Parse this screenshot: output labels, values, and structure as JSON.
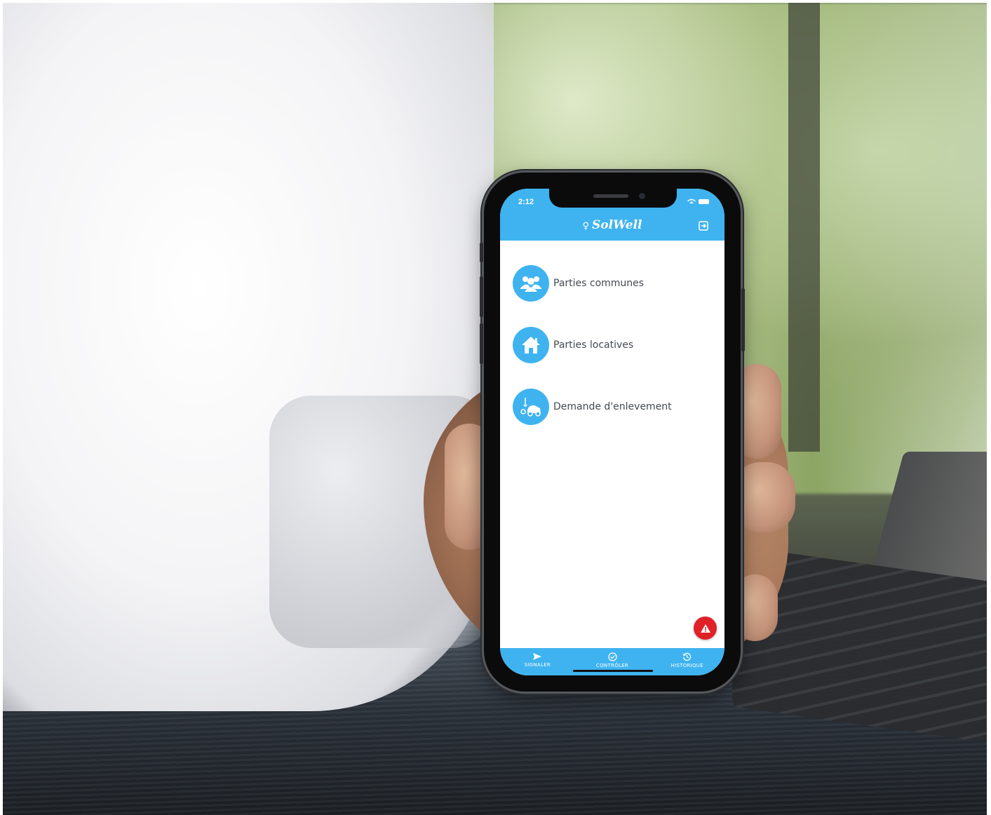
{
  "status_bar": {
    "time": "2:12"
  },
  "header": {
    "brand": "SolWell"
  },
  "menu": {
    "items": [
      {
        "label": "Parties communes",
        "icon": "people-group-icon"
      },
      {
        "label": "Parties locatives",
        "icon": "house-icon"
      },
      {
        "label": "Demande d'enlevement",
        "icon": "tow-truck-icon"
      }
    ]
  },
  "tabbar": {
    "tabs": [
      {
        "label": "SIGNALER",
        "icon": "send-icon"
      },
      {
        "label": "CONTRÔLER",
        "icon": "check-circle-icon"
      },
      {
        "label": "HISTORIQUE",
        "icon": "history-icon"
      }
    ]
  },
  "colors": {
    "primary": "#3fb3f0",
    "alert": "#e02228"
  }
}
